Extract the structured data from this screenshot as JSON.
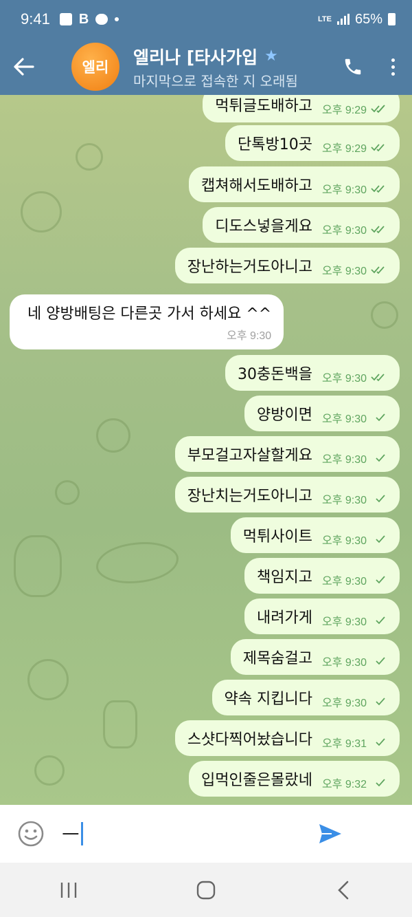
{
  "status_bar": {
    "time": "9:41",
    "b_badge": "B",
    "network": "LTE",
    "battery": "65%"
  },
  "header": {
    "avatar_text": "엘리",
    "title": "엘리나 [타사가입",
    "subtitle": "마지막으로 접속한 지 오래됨"
  },
  "messages": [
    {
      "text": "먹튀글도배하고",
      "time": "오후 9:29",
      "direction": "out",
      "status": "read"
    },
    {
      "text": "단톡방10곳",
      "time": "오후 9:29",
      "direction": "out",
      "status": "read"
    },
    {
      "text": "캡쳐해서도배하고",
      "time": "오후 9:30",
      "direction": "out",
      "status": "read"
    },
    {
      "text": "디도스넣을게요",
      "time": "오후 9:30",
      "direction": "out",
      "status": "read"
    },
    {
      "text": "장난하는거도아니고",
      "time": "오후 9:30",
      "direction": "out",
      "status": "read"
    },
    {
      "text": "네 양방배팅은 다른곳 가서 하세요 ^^",
      "time": "오후 9:30",
      "direction": "in"
    },
    {
      "text": "30충돈백을",
      "time": "오후 9:30",
      "direction": "out",
      "status": "read"
    },
    {
      "text": "양방이면",
      "time": "오후 9:30",
      "direction": "out",
      "status": "sent"
    },
    {
      "text": "부모걸고자살할게요",
      "time": "오후 9:30",
      "direction": "out",
      "status": "sent"
    },
    {
      "text": "장난치는거도아니고",
      "time": "오후 9:30",
      "direction": "out",
      "status": "sent"
    },
    {
      "text": "먹튀사이트",
      "time": "오후 9:30",
      "direction": "out",
      "status": "sent"
    },
    {
      "text": "책임지고",
      "time": "오후 9:30",
      "direction": "out",
      "status": "sent"
    },
    {
      "text": "내려가게",
      "time": "오후 9:30",
      "direction": "out",
      "status": "sent"
    },
    {
      "text": "제목숨걸고",
      "time": "오후 9:30",
      "direction": "out",
      "status": "sent"
    },
    {
      "text": "약속 지킵니다",
      "time": "오후 9:30",
      "direction": "out",
      "status": "sent"
    },
    {
      "text": "스샷다찍어놨습니다",
      "time": "오후 9:31",
      "direction": "out",
      "status": "sent"
    },
    {
      "text": "입먹인줄은몰랐네",
      "time": "오후 9:32",
      "direction": "out",
      "status": "sent"
    }
  ],
  "composer": {
    "value": "ㅡ"
  },
  "colors": {
    "header_bg": "#517da2",
    "outgoing_bubble": "#effdde",
    "incoming_bubble": "#ffffff",
    "tick_green": "#5fa55f",
    "send_blue": "#3a8ee6",
    "avatar_orange": "#f5901e"
  },
  "icons": {
    "back": "arrow-left-icon",
    "star": "star-icon",
    "call": "phone-icon",
    "menu": "more-vertical-icon",
    "emoji": "smiley-icon",
    "send": "send-icon",
    "nav_recents": "recents-icon",
    "nav_home": "home-icon",
    "nav_back": "nav-back-icon"
  }
}
